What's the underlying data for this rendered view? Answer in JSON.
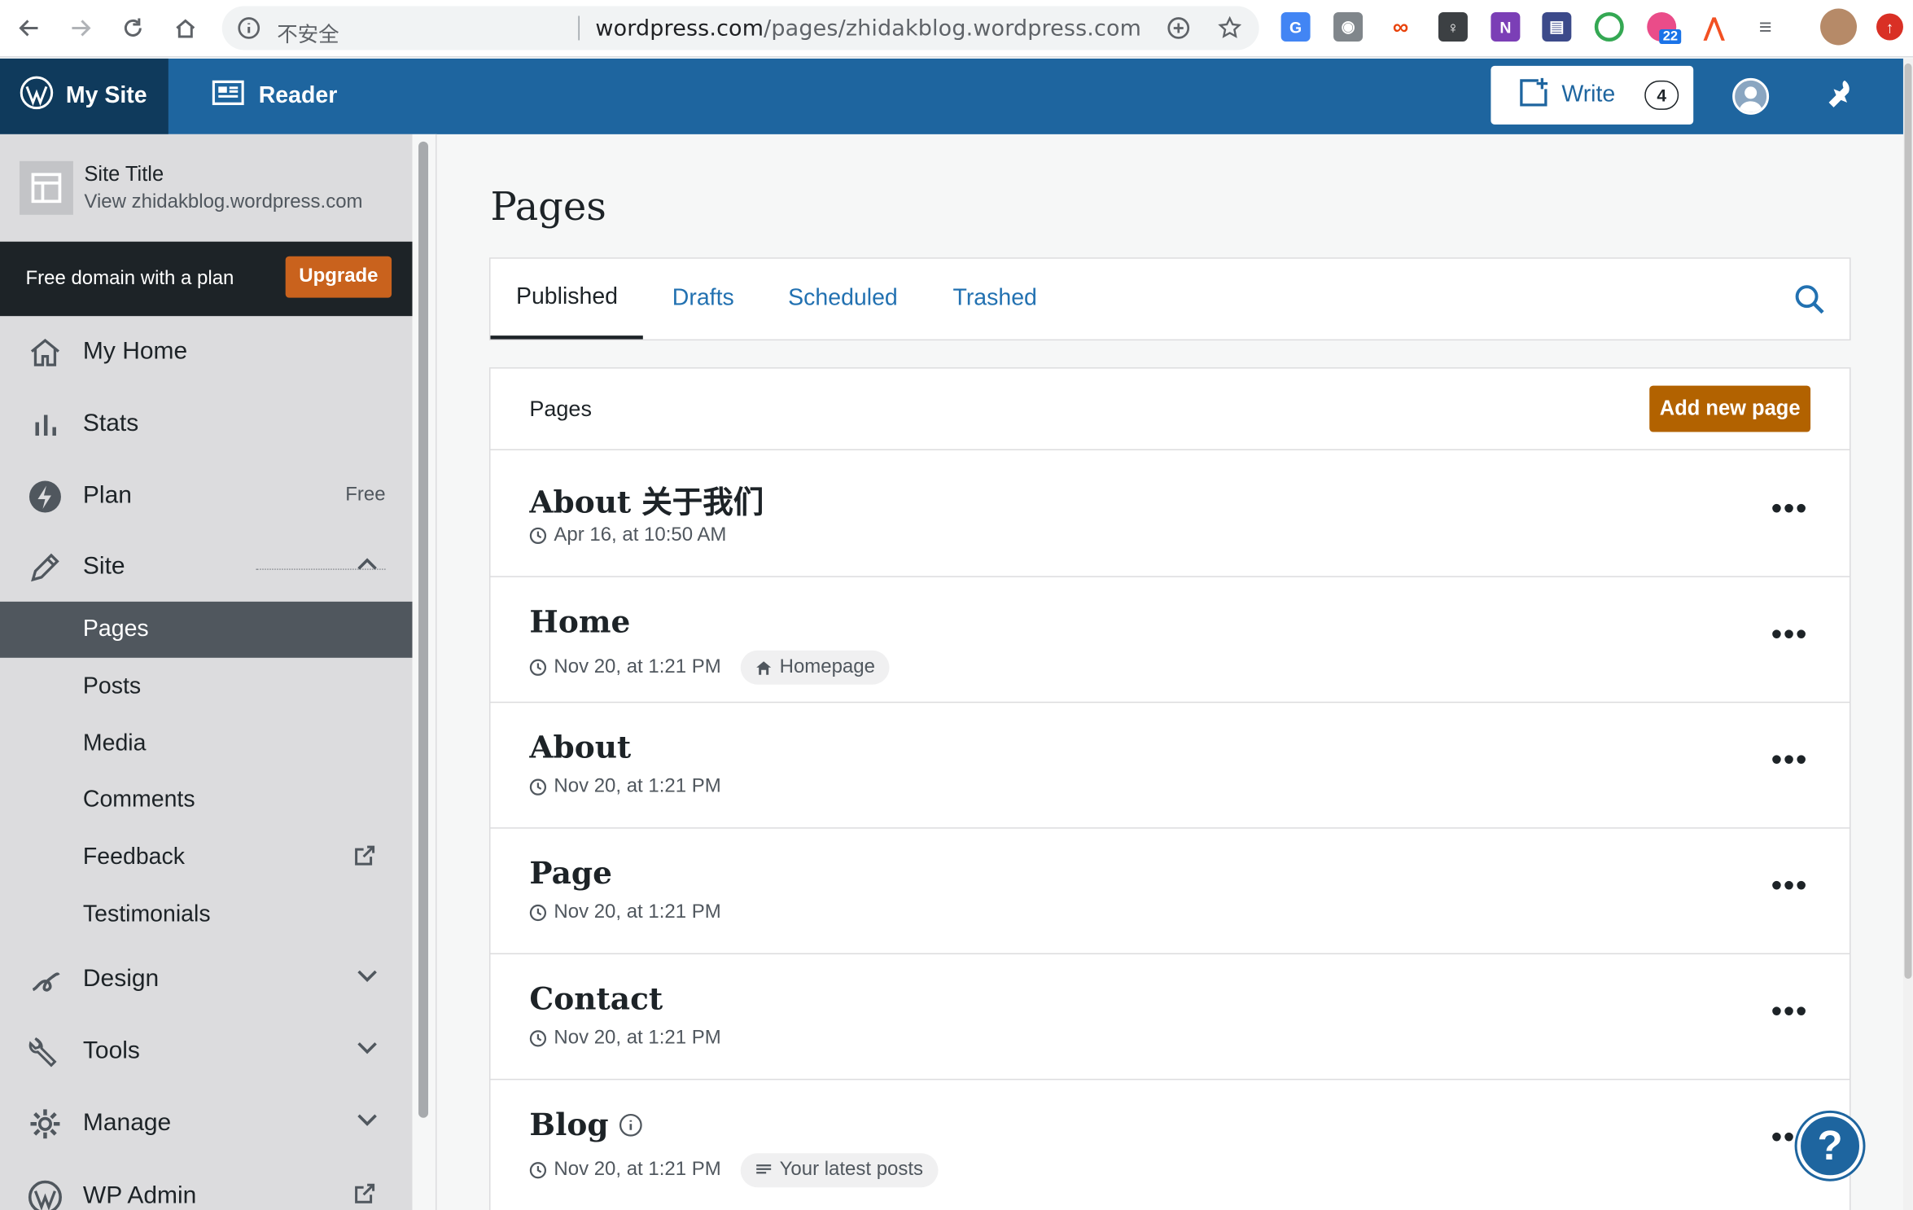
{
  "browser": {
    "security_label": "不安全",
    "url_host": "wordpress.com",
    "url_path": "/pages/zhidakblog.wordpress.com",
    "extension_badge": "22"
  },
  "masterbar": {
    "my_site": "My Site",
    "reader": "Reader",
    "write": "Write",
    "write_count": "4"
  },
  "sidebar": {
    "site_title": "Site Title",
    "site_url": "View zhidakblog.wordpress.com",
    "upsell_text": "Free domain with a plan",
    "upsell_button": "Upgrade",
    "items": {
      "home": "My Home",
      "stats": "Stats",
      "plan": "Plan",
      "plan_badge": "Free",
      "site": "Site",
      "design": "Design",
      "tools": "Tools",
      "manage": "Manage",
      "wp_admin": "WP Admin"
    },
    "site_sub": [
      "Pages",
      "Posts",
      "Media",
      "Comments",
      "Feedback",
      "Testimonials"
    ]
  },
  "main": {
    "title": "Pages",
    "tabs": [
      "Published",
      "Drafts",
      "Scheduled",
      "Trashed"
    ],
    "list_label": "Pages",
    "add_button": "Add new page",
    "pages": [
      {
        "title": "About 关于我们",
        "date": "Apr 16, at 10:50 AM",
        "badge": ""
      },
      {
        "title": "Home",
        "date": "Nov 20, at 1:21 PM",
        "badge": "Homepage"
      },
      {
        "title": "About",
        "date": "Nov 20, at 1:21 PM",
        "badge": ""
      },
      {
        "title": "Page",
        "date": "Nov 20, at 1:21 PM",
        "badge": ""
      },
      {
        "title": "Contact",
        "date": "Nov 20, at 1:21 PM",
        "badge": ""
      },
      {
        "title": "Blog",
        "date": "Nov 20, at 1:21 PM",
        "badge": "Your latest posts"
      }
    ],
    "help": "?"
  },
  "colors": {
    "masterbar": "#1e659f",
    "my_site_bg": "#0f3a5c",
    "upgrade": "#c9621d",
    "add_page": "#b26200",
    "link": "#2271b1"
  }
}
